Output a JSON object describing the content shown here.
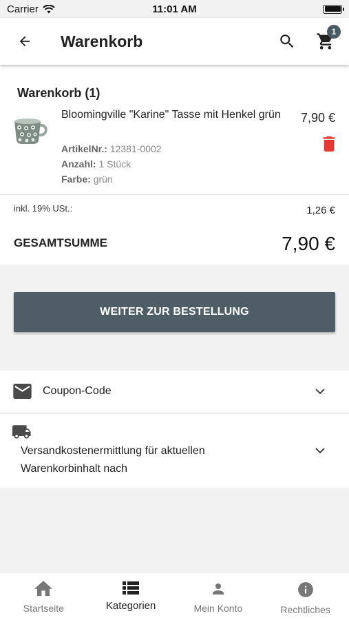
{
  "status_bar": {
    "carrier": "Carrier",
    "time": "11:01 AM"
  },
  "app_bar": {
    "title": "Warenkorb",
    "cart_count": "1"
  },
  "cart": {
    "heading": "Warenkorb (1)",
    "item": {
      "name": "Bloomingville \"Karine\" Tasse mit Henkel grün",
      "price": "7,90 €",
      "article_label": "ArtikelNr.:",
      "article_value": "12381-0002",
      "qty_label": "Anzahl:",
      "qty_value": "1 Stück",
      "color_label": "Farbe:",
      "color_value": "grün"
    }
  },
  "totals": {
    "vat_label": "inkl. 19% USt.:",
    "vat_value": "1,26 €",
    "total_label": "GESAMTSUMME",
    "total_value": "7,90 €"
  },
  "order_button": "WEITER ZUR BESTELLUNG",
  "coupon": {
    "label": "Coupon-Code"
  },
  "shipping": {
    "label_line1": "Versandkostenermittlung für aktuellen",
    "label_line2": "Warenkorbinhalt nach"
  },
  "bottom_nav": {
    "items": [
      {
        "label": "Startseite",
        "icon": "home-icon"
      },
      {
        "label": "Kategorien",
        "icon": "list-icon"
      },
      {
        "label": "Mein Konto",
        "icon": "person-icon"
      },
      {
        "label": "Rechtliches",
        "icon": "info-icon"
      }
    ],
    "active_index": 1
  },
  "colors": {
    "accent": "#4f5e66",
    "delete": "#e53935",
    "background": "#f2f2f2"
  }
}
